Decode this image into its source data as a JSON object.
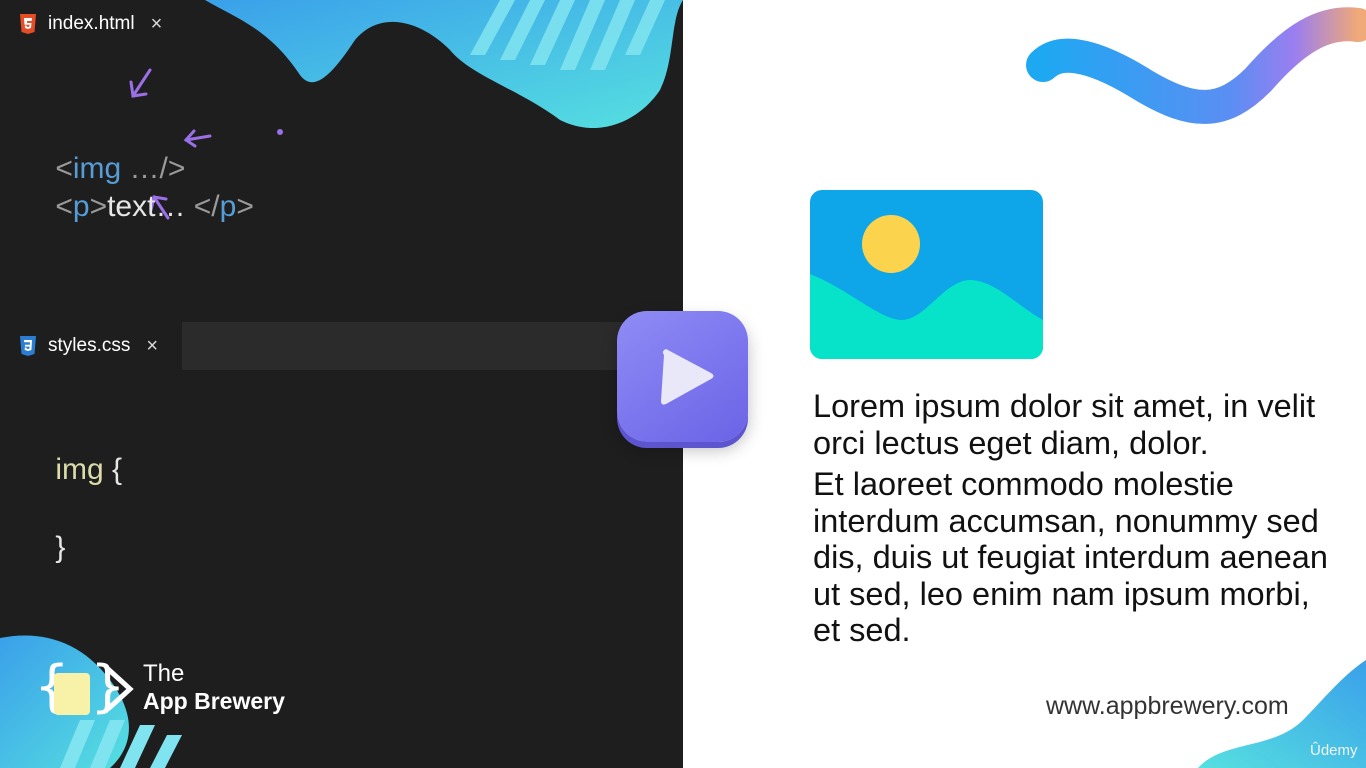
{
  "html_panel": {
    "tab": {
      "title": "index.html",
      "icon": "html5-icon",
      "close": "×"
    },
    "lines": [
      {
        "open": "<",
        "tag": "img",
        "rest": " …/>"
      },
      {
        "open": "<",
        "tag": "p",
        "close_open": ">",
        "text": "text…",
        "end_open": " </",
        "end_tag": "p",
        "end_close": ">"
      }
    ]
  },
  "css_panel": {
    "tab": {
      "title": "styles.css",
      "icon": "css3-icon",
      "close": "×"
    },
    "selector": "img",
    "open_brace": " {",
    "close_brace": "}"
  },
  "play_button": {
    "icon": "play-icon"
  },
  "preview": {
    "image_icon": "image-placeholder-icon",
    "paragraph_1": "Lorem ipsum dolor sit amet, in velit orci lectus eget diam, dolor.",
    "paragraph_2": "Et laoreet commodo molestie interdum accumsan, nonummy sed dis, duis ut feugiat interdum aenean ut sed, leo enim nam ipsum morbi, et sed.",
    "website": "www.appbrewery.com",
    "watermark": "Ûdemy"
  },
  "brand": {
    "line1": "The",
    "line2": "App Brewery",
    "logo": "app-brewery-logo"
  },
  "colors": {
    "editor_bg": "#1e1e1e",
    "tab_bar": "#2b2b2b",
    "tag_blue": "#569cd6",
    "selector_yellow": "#dcdcaa",
    "play_purple": "#7b76ee",
    "annotation_purple": "#9b6fe8"
  }
}
